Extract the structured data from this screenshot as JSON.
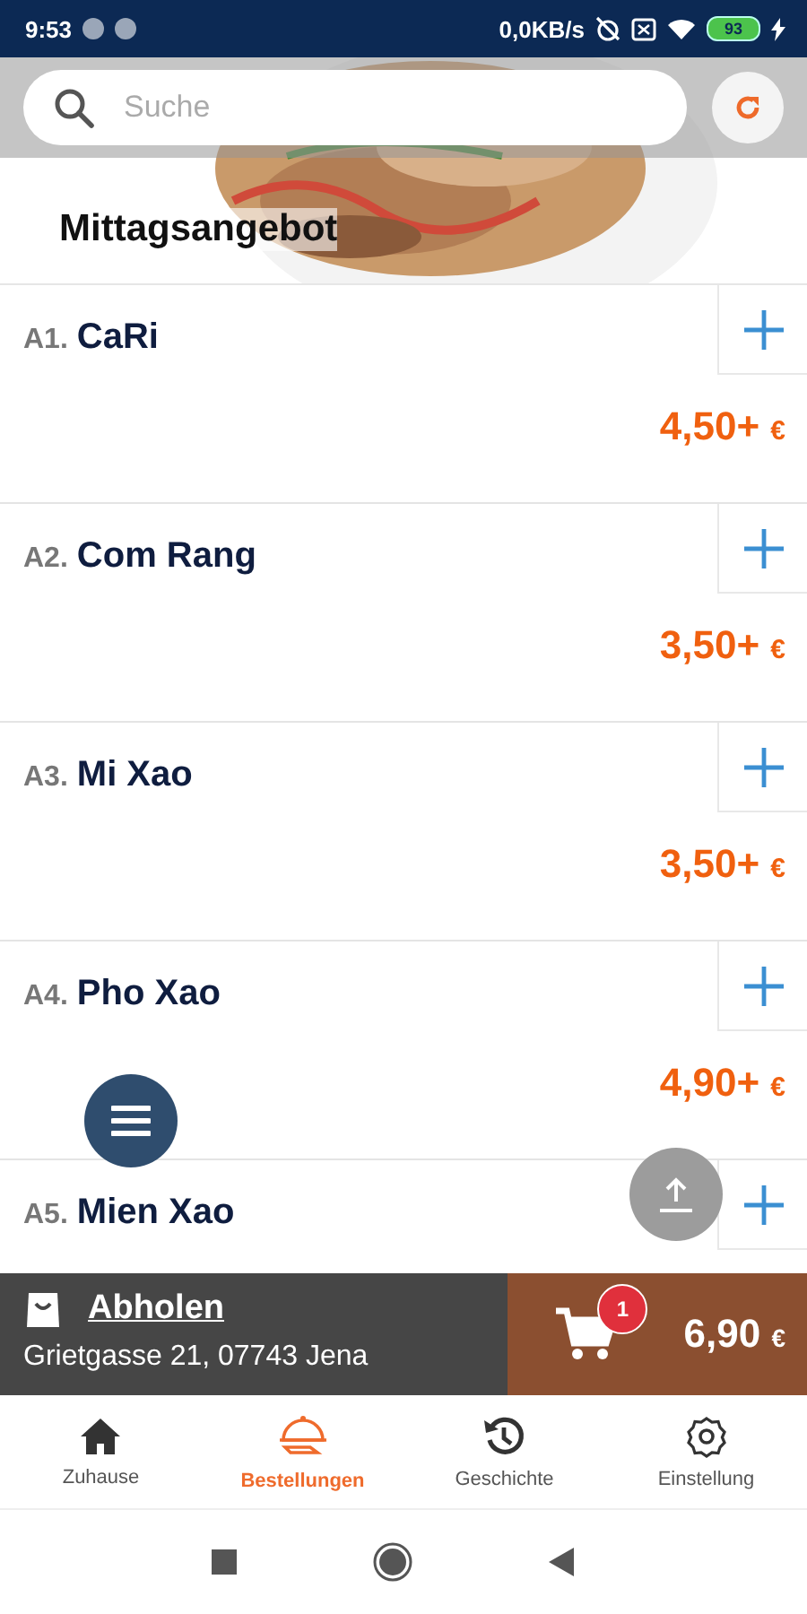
{
  "status_bar": {
    "time": "9:53",
    "net_speed": "0,0KB/s",
    "battery": "93"
  },
  "search": {
    "placeholder": "Suche"
  },
  "header": {
    "title": "Mittagsangebot"
  },
  "items": [
    {
      "code": "A1.",
      "name": "CaRi",
      "price": "4,50+",
      "currency": "€"
    },
    {
      "code": "A2.",
      "name": "Com Rang",
      "price": "3,50+",
      "currency": "€"
    },
    {
      "code": "A3.",
      "name": "Mi Xao",
      "price": "3,50+",
      "currency": "€"
    },
    {
      "code": "A4.",
      "name": "Pho Xao",
      "price": "4,90+",
      "currency": "€"
    },
    {
      "code": "A5.",
      "name": "Mien Xao"
    }
  ],
  "pickup": {
    "label": "Abholen",
    "address": "Grietgasse 21, 07743 Jena"
  },
  "cart": {
    "count": "1",
    "total": "6,90",
    "currency": "€"
  },
  "nav": [
    {
      "label": "Zuhause",
      "kind": "home",
      "selected": false
    },
    {
      "label": "Bestellungen",
      "kind": "orders",
      "selected": true
    },
    {
      "label": "Geschichte",
      "kind": "history",
      "selected": false
    },
    {
      "label": "Einstellung",
      "kind": "settings",
      "selected": false
    }
  ]
}
